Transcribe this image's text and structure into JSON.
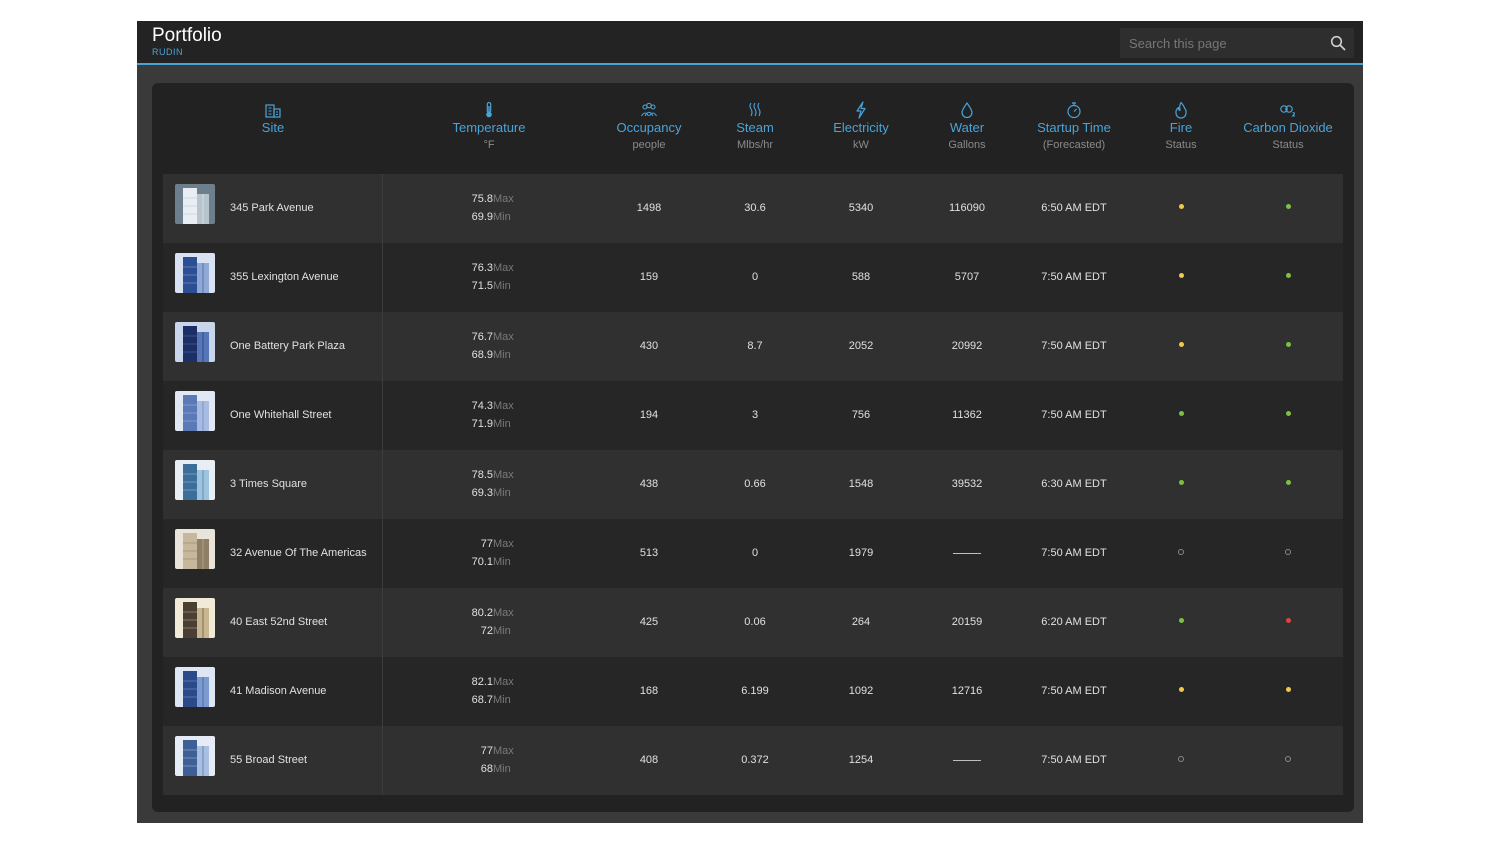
{
  "header": {
    "title": "Portfolio",
    "subtitle": "RUDIN"
  },
  "search": {
    "placeholder": "Search this page",
    "value": ""
  },
  "columns": [
    {
      "key": "site",
      "label": "Site",
      "unit": "",
      "icon": "building-icon"
    },
    {
      "key": "temperature",
      "label": "Temperature",
      "unit": "°F",
      "icon": "thermometer-icon"
    },
    {
      "key": "occupancy",
      "label": "Occupancy",
      "unit": "people",
      "icon": "people-icon"
    },
    {
      "key": "steam",
      "label": "Steam",
      "unit": "Mlbs/hr",
      "icon": "steam-icon"
    },
    {
      "key": "electricity",
      "label": "Electricity",
      "unit": "kW",
      "icon": "lightning-icon"
    },
    {
      "key": "water",
      "label": "Water",
      "unit": "Gallons",
      "icon": "water-drop-icon"
    },
    {
      "key": "startup",
      "label": "Startup Time",
      "unit": "(Forecasted)",
      "icon": "stopwatch-icon"
    },
    {
      "key": "fire",
      "label": "Fire",
      "unit": "Status",
      "icon": "flame-icon"
    },
    {
      "key": "co2",
      "label": "Carbon Dioxide",
      "unit": "Status",
      "icon": "co2-icon"
    }
  ],
  "temp_labels": {
    "max": "Max",
    "min": "Min"
  },
  "status_colors": {
    "yellow": "#f2c94c",
    "green": "#7dc142",
    "red": "#e0443e",
    "none": "#8a8a8a"
  },
  "rows": [
    {
      "site": "345 Park Avenue",
      "temp_max": "75.8",
      "temp_min": "69.9",
      "occupancy": "1498",
      "steam": "30.6",
      "electricity": "5340",
      "water": "116090",
      "startup": "6:50 AM EDT",
      "fire": "yellow",
      "co2": "green"
    },
    {
      "site": "355 Lexington Avenue",
      "temp_max": "76.3",
      "temp_min": "71.5",
      "occupancy": "159",
      "steam": "0",
      "electricity": "588",
      "water": "5707",
      "startup": "7:50 AM EDT",
      "fire": "yellow",
      "co2": "green"
    },
    {
      "site": "One Battery Park Plaza",
      "temp_max": "76.7",
      "temp_min": "68.9",
      "occupancy": "430",
      "steam": "8.7",
      "electricity": "2052",
      "water": "20992",
      "startup": "7:50 AM EDT",
      "fire": "yellow",
      "co2": "green"
    },
    {
      "site": "One Whitehall Street",
      "temp_max": "74.3",
      "temp_min": "71.9",
      "occupancy": "194",
      "steam": "3",
      "electricity": "756",
      "water": "11362",
      "startup": "7:50 AM EDT",
      "fire": "green",
      "co2": "green"
    },
    {
      "site": "3 Times Square",
      "temp_max": "78.5",
      "temp_min": "69.3",
      "occupancy": "438",
      "steam": "0.66",
      "electricity": "1548",
      "water": "39532",
      "startup": "6:30 AM EDT",
      "fire": "green",
      "co2": "green"
    },
    {
      "site": "32 Avenue Of The Americas",
      "temp_max": "77",
      "temp_min": "70.1",
      "occupancy": "513",
      "steam": "0",
      "electricity": "1979",
      "water": null,
      "startup": "7:50 AM EDT",
      "fire": "none",
      "co2": "none"
    },
    {
      "site": "40 East 52nd Street",
      "temp_max": "80.2",
      "temp_min": "72",
      "occupancy": "425",
      "steam": "0.06",
      "electricity": "264",
      "water": "20159",
      "startup": "6:20 AM EDT",
      "fire": "green",
      "co2": "red"
    },
    {
      "site": "41 Madison Avenue",
      "temp_max": "82.1",
      "temp_min": "68.7",
      "occupancy": "168",
      "steam": "6.199",
      "electricity": "1092",
      "water": "12716",
      "startup": "7:50 AM EDT",
      "fire": "yellow",
      "co2": "yellow"
    },
    {
      "site": "55 Broad Street",
      "temp_max": "77",
      "temp_min": "68",
      "occupancy": "408",
      "steam": "0.372",
      "electricity": "1254",
      "water": null,
      "startup": "7:50 AM EDT",
      "fire": "none",
      "co2": "none"
    }
  ]
}
